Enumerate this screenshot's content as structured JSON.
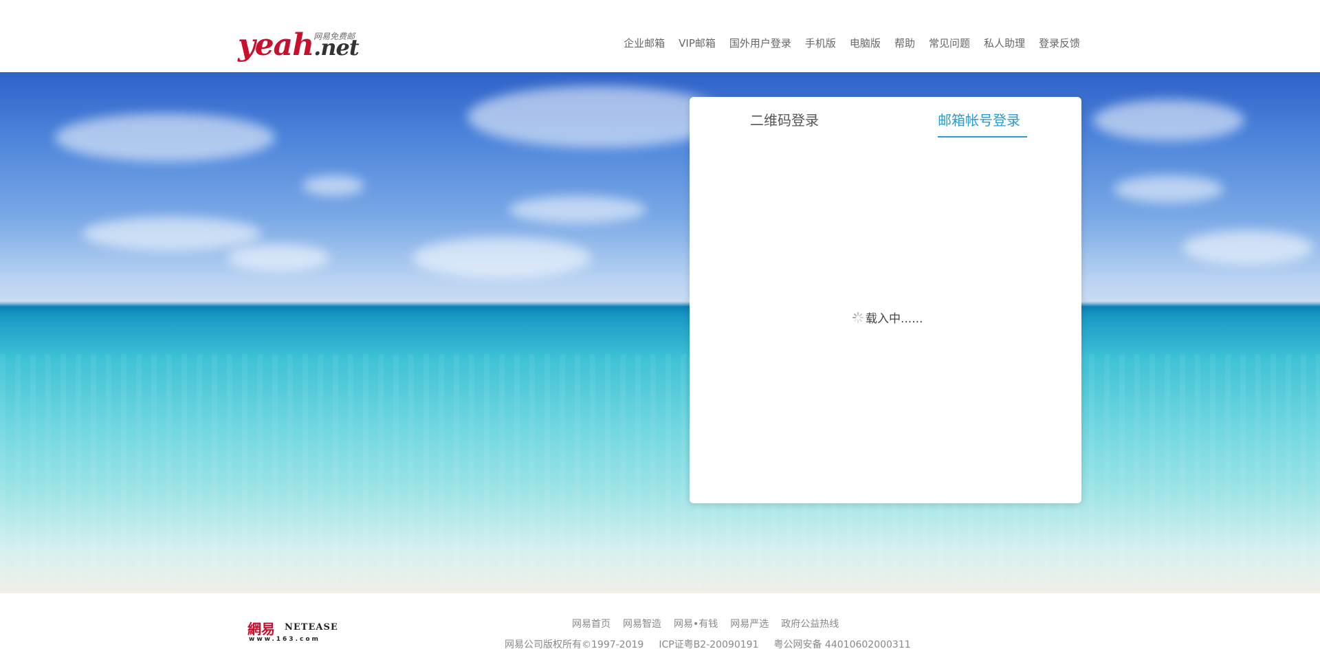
{
  "header": {
    "logo_sub": "网易免费邮",
    "logo_yeah": "yeah",
    "logo_net": ".net",
    "nav": [
      "企业邮箱",
      "VIP邮箱",
      "国外用户登录",
      "手机版",
      "电脑版",
      "帮助",
      "常见问题",
      "私人助理",
      "登录反馈"
    ]
  },
  "login": {
    "tab_qr": "二维码登录",
    "tab_account": "邮箱帐号登录",
    "active_tab": "邮箱帐号登录",
    "loading_text": "载入中......"
  },
  "footer": {
    "brand_cn": "網易",
    "brand_en": "NETEASE",
    "brand_url": "www.163.com",
    "links": [
      "网易首页",
      "网易智造",
      "网易•有钱",
      "网易严选",
      "政府公益热线"
    ],
    "copyright": "网易公司版权所有©1997-2019",
    "icp": "ICP证粤B2-20090191",
    "police": "粤公网安备 44010602000311"
  },
  "colors": {
    "brand_red": "#c8102e",
    "accent_blue": "#2a9ad3"
  }
}
